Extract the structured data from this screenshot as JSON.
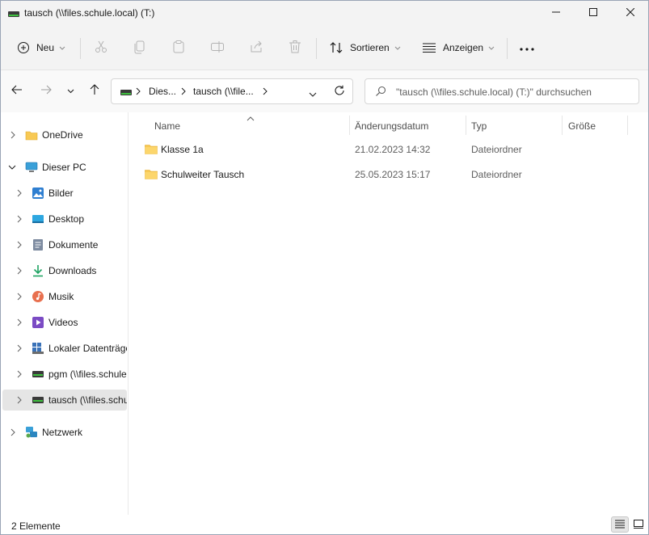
{
  "window": {
    "title": "tausch (\\\\files.schule.local) (T:)",
    "controls": {
      "minimize": "minimize",
      "maximize": "maximize",
      "close": "close"
    }
  },
  "toolbar": {
    "new_label": "Neu",
    "sort_label": "Sortieren",
    "view_label": "Anzeigen",
    "icons": [
      "cut-icon",
      "copy-icon",
      "paste-icon",
      "rename-icon",
      "share-icon",
      "delete-icon"
    ]
  },
  "address": {
    "crumbs": [
      "Dies...",
      "tausch (\\\\file..."
    ],
    "search_placeholder": "\"tausch (\\\\files.schule.local) (T:)\" durchsuchen"
  },
  "sidebar": {
    "items": [
      {
        "label": "OneDrive",
        "icon": "onedrive-folder-icon"
      },
      {
        "label": "Dieser PC",
        "icon": "this-pc-icon"
      },
      {
        "label": "Bilder",
        "icon": "pictures-icon"
      },
      {
        "label": "Desktop",
        "icon": "desktop-icon"
      },
      {
        "label": "Dokumente",
        "icon": "documents-icon"
      },
      {
        "label": "Downloads",
        "icon": "downloads-icon"
      },
      {
        "label": "Musik",
        "icon": "music-icon"
      },
      {
        "label": "Videos",
        "icon": "videos-icon"
      },
      {
        "label": "Lokaler Datenträger",
        "icon": "local-disk-icon"
      },
      {
        "label": "pgm (\\\\files.schule.local) (P:)",
        "icon": "network-drive-icon"
      },
      {
        "label": "tausch (\\\\files.schule.local) (T:)",
        "icon": "network-drive-icon",
        "selected": true
      },
      {
        "label": "Netzwerk",
        "icon": "network-icon"
      }
    ]
  },
  "filelist": {
    "columns": [
      "Name",
      "Änderungsdatum",
      "Typ",
      "Größe"
    ],
    "rows": [
      {
        "name": "Klasse 1a",
        "date": "21.02.2023 14:32",
        "type": "Dateiordner"
      },
      {
        "name": "Schulweiter Tausch",
        "date": "25.05.2023 15:17",
        "type": "Dateiordner"
      }
    ]
  },
  "status": {
    "count": "2 Elemente"
  },
  "colors": {
    "folder": "#f8c954",
    "accent": "#0067c0",
    "selection": "#e5e5e5"
  }
}
